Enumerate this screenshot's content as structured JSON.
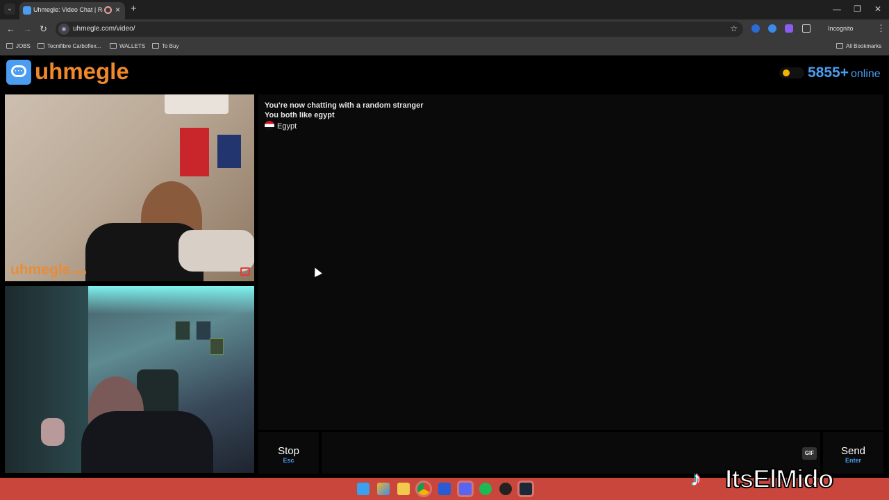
{
  "browser": {
    "tab_title": "Uhmegle: Video Chat | Ran",
    "new_tab": "+",
    "url": "uhmegle.com/video/",
    "profile_label": "Incognito",
    "bookmarks": [
      {
        "label": "JOBS"
      },
      {
        "label": "Tecnifibre Carboflex..."
      },
      {
        "label": "WALLETS"
      },
      {
        "label": "To Buy"
      }
    ],
    "all_bookmarks": "All Bookmarks"
  },
  "site": {
    "logo_text": "uhmegle",
    "online_count": "5855+",
    "online_label": "online",
    "watermark": "uhmegle",
    "watermark_suffix": ".com"
  },
  "chat": {
    "messages": [
      "You're now chatting with a random stranger",
      "You both like egypt"
    ],
    "country": "Egypt"
  },
  "controls": {
    "stop_label": "Stop",
    "stop_key": "Esc",
    "gif_label": "GIF",
    "send_label": "Send",
    "send_key": "Enter"
  },
  "overlay": {
    "creator": "ItsElMido"
  },
  "colors": {
    "brand": "#f0892a",
    "accent": "#4a9df0",
    "taskbar": "#c9463d"
  }
}
